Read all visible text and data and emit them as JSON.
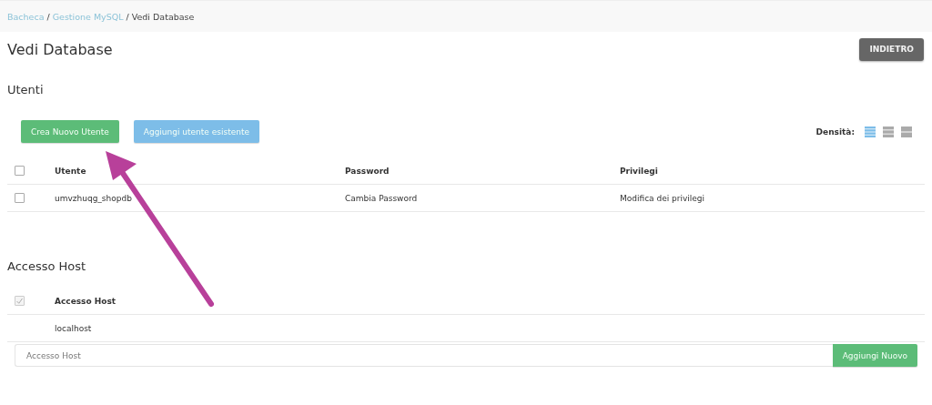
{
  "breadcrumb_separator": "/",
  "breadcrumb": [
    {
      "label": "Bacheca",
      "link": true
    },
    {
      "label": "Gestione MySQL",
      "link": true
    },
    {
      "label": "Vedi Database",
      "link": false
    }
  ],
  "title": "Vedi Database",
  "back_button": "INDIETRO",
  "users": {
    "heading": "Utenti",
    "buttons": [
      {
        "label": "Crea Nuovo Utente",
        "kind": "success"
      },
      {
        "label": "Aggiungi utente esistente",
        "kind": "info"
      }
    ],
    "density": {
      "label": "Densità:",
      "options": [
        {
          "selected": true
        },
        {
          "selected": false
        },
        {
          "selected": false
        }
      ]
    },
    "columns": [
      "Utente",
      "Password",
      "Privilegi"
    ],
    "header_checked": false,
    "rows": [
      {
        "checked": false,
        "cells": [
          "umvzhuqg_shopdb",
          "Cambia Password",
          "Modifica dei privilegi"
        ]
      }
    ]
  },
  "hosts": {
    "heading": "Accesso Host",
    "header_checked": true,
    "header_disabled": true,
    "column": "Accesso Host",
    "rows": [
      "localhost"
    ],
    "input": {
      "placeholder": "Accesso Host"
    },
    "add_button": "Aggiungi Nuovo"
  }
}
